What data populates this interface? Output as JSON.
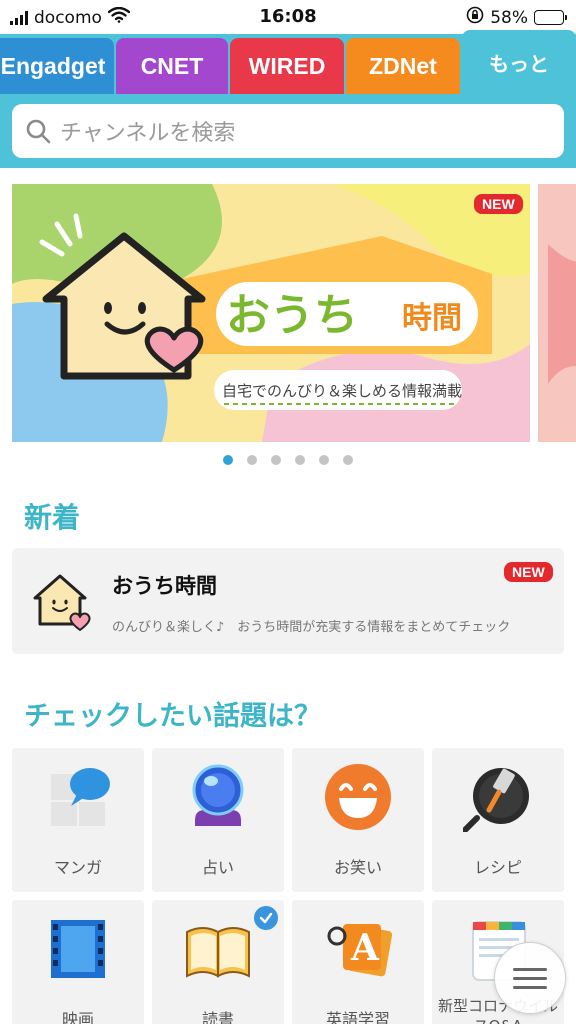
{
  "status_bar": {
    "carrier": "docomo",
    "time": "16:08",
    "battery_percent": "58%",
    "battery_level": 0.58,
    "icons": [
      "signal-icon",
      "wifi-icon",
      "rotation-lock-icon",
      "battery-icon"
    ]
  },
  "channel_tabs": [
    {
      "label": "Engadget",
      "color": "#2f8fd5"
    },
    {
      "label": "CNET",
      "color": "#a347cf"
    },
    {
      "label": "WIRED",
      "color": "#e8384a"
    },
    {
      "label": "ZDNet",
      "color": "#f58a1f"
    },
    {
      "label": "もっと",
      "color": "#4ec2d8",
      "active": true
    }
  ],
  "search": {
    "placeholder": "チャンネルを検索",
    "icon": "search-icon"
  },
  "banner": {
    "badge": "NEW",
    "title_kana": "おうち",
    "title_kanji": "時間",
    "subtitle": "自宅でのんびり＆楽しめる情報満載",
    "slide_count": 6,
    "active_slide": 1
  },
  "new_section": {
    "heading": "新着",
    "card": {
      "title": "おうち時間",
      "badge": "NEW",
      "description": "のんびり＆楽しく♪　おうち時間が充実する情報をまとめてチェック"
    }
  },
  "topics_section": {
    "heading": "チェックしたい話題は？",
    "items": [
      {
        "label": "マンガ",
        "icon": "manga-icon",
        "checked": false
      },
      {
        "label": "占い",
        "icon": "crystal-ball-icon",
        "checked": false
      },
      {
        "label": "お笑い",
        "icon": "laughing-face-icon",
        "checked": false
      },
      {
        "label": "レシピ",
        "icon": "frying-pan-icon",
        "checked": false
      },
      {
        "label": "映画",
        "icon": "film-icon",
        "checked": false
      },
      {
        "label": "読書",
        "icon": "book-icon",
        "checked": true
      },
      {
        "label": "英語学習",
        "icon": "english-cards-icon",
        "checked": false
      },
      {
        "label": "新型コロナウイルスQ&A",
        "icon": "clipboard-icon",
        "checked": false
      }
    ]
  },
  "fab": {
    "icon": "menu-icon"
  },
  "colors": {
    "accent": "#3db5c9",
    "header": "#4ec2d8",
    "badge_red": "#e3282e",
    "indicator": "#2fa3d6"
  }
}
